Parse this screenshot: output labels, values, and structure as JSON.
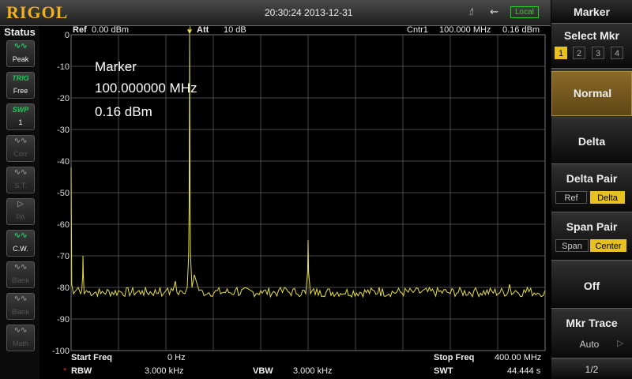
{
  "header": {
    "brand": "RIGOL",
    "datetime": "20:30:24 2013-12-31",
    "usb_icon": "usb-icon",
    "connection_badge": "Local"
  },
  "status": {
    "title": "Status",
    "items": [
      {
        "glyph": "∿∿",
        "label": "Peak",
        "state": "on",
        "kind": "wav"
      },
      {
        "glyph": "TRIG",
        "label": "Free",
        "state": "on",
        "kind": "txt"
      },
      {
        "glyph": "SWP",
        "label": "1",
        "state": "on",
        "kind": "txt"
      },
      {
        "glyph": "∿∿",
        "label": "Corr",
        "state": "off",
        "kind": "wav"
      },
      {
        "glyph": "∿∿",
        "label": "S.T.",
        "state": "off",
        "kind": "wav"
      },
      {
        "glyph": "▷",
        "label": "PA",
        "state": "off",
        "kind": "wav"
      },
      {
        "glyph": "∿∿",
        "label": "C.W.",
        "state": "on",
        "kind": "wav"
      },
      {
        "glyph": "∿∿",
        "label": "Blank",
        "state": "off",
        "kind": "wav"
      },
      {
        "glyph": "∿∿",
        "label": "Blank",
        "state": "off",
        "kind": "wav"
      },
      {
        "glyph": "∿∿",
        "label": "Math",
        "state": "off",
        "kind": "wav"
      }
    ]
  },
  "plot_header": {
    "ref_label": "Ref",
    "ref_value": "0.00 dBm",
    "att_label": "Att",
    "att_value": "10 dB",
    "cntr_label": "Cntr1",
    "cntr_value": "100.000 MHz",
    "cntr_level": "0.16 dBm"
  },
  "marker_box": {
    "title": "Marker",
    "frequency": "100.000000 MHz",
    "level": "0.16 dBm"
  },
  "footer": {
    "start_freq_label": "Start Freq",
    "start_freq_value": "0 Hz",
    "stop_freq_label": "Stop Freq",
    "stop_freq_value": "400.00 MHz",
    "rbw_flag": "*",
    "rbw_label": "RBW",
    "rbw_value": "3.000 kHz",
    "vbw_label": "VBW",
    "vbw_value": "3.000 kHz",
    "swt_label": "SWT",
    "swt_value": "44.444 s"
  },
  "softkeys": {
    "menu_title": "Marker",
    "select_mkr": {
      "label": "Select Mkr",
      "options": [
        "1",
        "2",
        "3",
        "4"
      ],
      "selected": "1"
    },
    "normal": "Normal",
    "delta": "Delta",
    "delta_pair": {
      "label": "Delta Pair",
      "options": [
        "Ref",
        "Delta"
      ],
      "selected": "Delta"
    },
    "span_pair": {
      "label": "Span Pair",
      "options": [
        "Span",
        "Center"
      ],
      "selected": "Center"
    },
    "off": "Off",
    "mkr_trace": {
      "label": "Mkr Trace",
      "value": "Auto"
    },
    "page": "1/2"
  },
  "colors": {
    "trace": "#e8e040",
    "grid": "#4a4a4a",
    "accent": "#e8c020",
    "status_on": "#22c85a"
  },
  "chart_data": {
    "type": "line",
    "title": "",
    "xlabel": "",
    "ylabel": "",
    "xlim_mhz": [
      0,
      400
    ],
    "ylim": [
      -100,
      0
    ],
    "yticks": [
      0,
      -10,
      -20,
      -30,
      -40,
      -50,
      -60,
      -70,
      -80,
      -90,
      -100
    ],
    "grid": true,
    "noise_floor_dbm": -81.5,
    "series": [
      {
        "x_mhz": [
          0,
          0.5,
          2,
          4,
          6,
          8,
          9,
          9.8,
          10,
          10.3,
          11,
          13,
          25,
          40,
          60,
          75,
          78,
          80,
          86,
          88,
          92,
          96,
          98,
          99.2,
          99.6,
          100,
          100.4,
          100.8,
          102,
          104,
          108,
          115,
          140,
          160,
          175,
          180,
          190,
          198,
          199.6,
          200,
          200.4,
          202,
          210,
          230,
          260,
          290,
          320,
          340,
          370,
          375,
          385,
          395,
          400
        ],
        "y_dbm": [
          -42,
          -79,
          -82,
          -81,
          -80,
          -82,
          -81,
          -76,
          -70,
          -76,
          -82,
          -81,
          -82,
          -81,
          -81,
          -80,
          -82,
          -81,
          -81,
          -78,
          -81,
          -82,
          -80,
          -70,
          -55,
          0.16,
          -55,
          -70,
          -80,
          -76,
          -81,
          -82,
          -80,
          -81,
          -81,
          -80,
          -82,
          -82,
          -75,
          -65,
          -75,
          -82,
          -81,
          -82,
          -80,
          -81,
          -82,
          -81,
          -79,
          -81,
          -80,
          -82,
          -81
        ]
      }
    ],
    "marker": {
      "x_mhz": 100,
      "y_dbm": 0.16,
      "label": "1"
    }
  }
}
